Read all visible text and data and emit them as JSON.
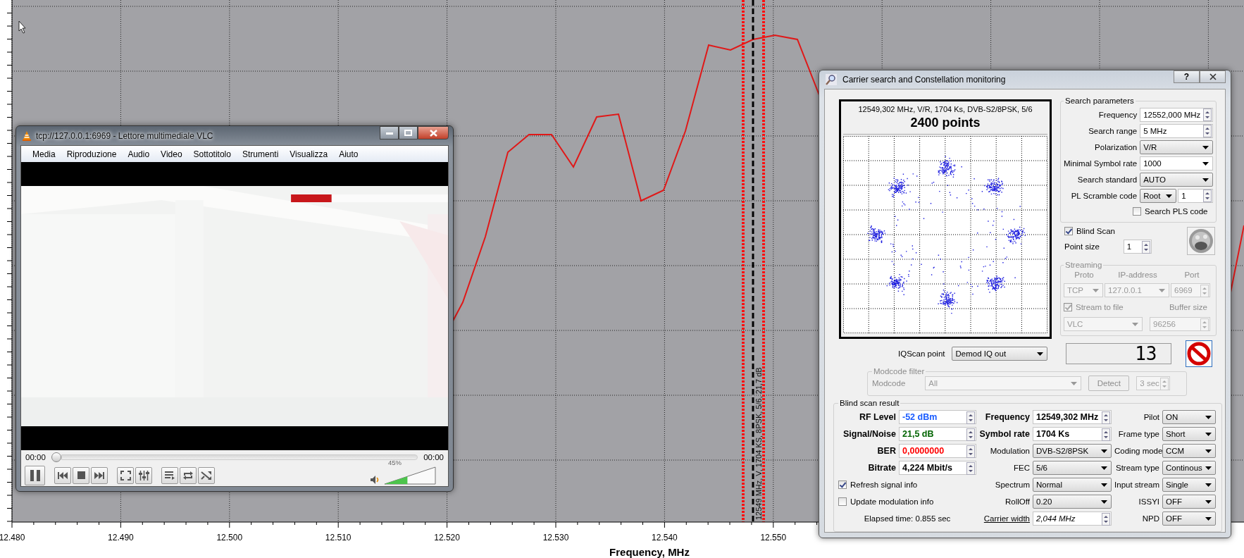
{
  "chart": {
    "x_ticks": [
      "12.480",
      "12.490",
      "12.500",
      "12.510",
      "12.520",
      "12.530",
      "12.540",
      "12.550"
    ],
    "x_label": "Frequency, MHz",
    "marker_label": "12549 MHz, V, 1704 KS, 8PSK, 5/6, 21,7 dB"
  },
  "vlc": {
    "title": "tcp://127.0.0.1:6969 - Lettore multimediale VLC",
    "menu": [
      "Media",
      "Riproduzione",
      "Audio",
      "Video",
      "Sottotitolo",
      "Strumenti",
      "Visualizza",
      "Aiuto"
    ],
    "elapsed": "00:00",
    "total": "00:00",
    "seek": {
      "level": 0
    },
    "volume": {
      "level": 0.45,
      "reading": "45%"
    }
  },
  "dialog": {
    "title": "Carrier search and Constellation monitoring",
    "help": "?",
    "constellation": {
      "info": "12549,302 MHz, V/R, 1704 Ks, DVB-S2/8PSK, 5/6",
      "points": "2400 points"
    },
    "search": {
      "title": "Search parameters",
      "fields": [
        {
          "label": "Frequency",
          "value": "12552,000 MHz",
          "kind": "spin"
        },
        {
          "label": "Search range",
          "value": "5 MHz",
          "kind": "spin"
        },
        {
          "label": "Polarization",
          "value": "V/R",
          "kind": "select"
        },
        {
          "label": "Minimal Symbol rate",
          "value": "1000",
          "kind": "combo"
        },
        {
          "label": "Search standard",
          "value": "AUTO",
          "kind": "select"
        },
        {
          "label": "PL Scramble code",
          "value": "Root",
          "extra": "1",
          "kind": "split"
        }
      ],
      "pls": {
        "label": "Search PLS code",
        "checked": false
      }
    },
    "blind_scan": {
      "label": "Blind Scan",
      "checked": true
    },
    "point_size": {
      "label": "Point size",
      "value": "1"
    },
    "streaming": {
      "title": "Streaming",
      "disabled": true,
      "proto_label": "Proto",
      "ip_label": "IP-address",
      "port_label": "Port",
      "proto": "TCP",
      "ip": "127.0.0.1",
      "port": "6969",
      "to_file": {
        "label": "Stream to file",
        "checked": true
      },
      "buffer_label": "Buffer size",
      "player": "VLC",
      "buffer": "96256"
    },
    "iq_scan": {
      "label": "IQScan point",
      "value": "Demod IQ out"
    },
    "counter": "13",
    "modcode": {
      "title": "Modcode filter",
      "disabled": true,
      "label": "Modcode",
      "value": "All",
      "detect": "Detect",
      "timeout": "3 sec"
    },
    "result": {
      "title": "Blind scan result",
      "left": [
        {
          "label": "RF Level",
          "value": "-52 dBm",
          "color": "#1a5cff"
        },
        {
          "label": "Signal/Noise",
          "value": "21,5 dB",
          "color": "#006400"
        },
        {
          "label": "BER",
          "value": "0,0000000",
          "color": "#ff0000"
        },
        {
          "label": "Bitrate",
          "value": "4,224 Mbit/s",
          "color": "#000000"
        }
      ],
      "checks": [
        {
          "label": "Refresh signal info",
          "checked": true
        },
        {
          "label": "Update modulation info",
          "checked": false
        }
      ],
      "elapsed": "Elapsed time: 0.855 sec",
      "middle": [
        {
          "label": "Frequency",
          "value": "12549,302 MHz",
          "kind": "spin",
          "bold": true
        },
        {
          "label": "Symbol rate",
          "value": "1704 Ks",
          "kind": "spin",
          "bold": true
        },
        {
          "label": "Modulation",
          "value": "DVB-S2/8PSK",
          "kind": "select",
          "bold": false
        },
        {
          "label": "FEC",
          "value": "5/6",
          "kind": "select",
          "bold": false
        },
        {
          "label": "Spectrum",
          "value": "Normal",
          "kind": "select",
          "bold": false
        },
        {
          "label": "RollOff",
          "value": "0.20",
          "kind": "select",
          "bold": false
        },
        {
          "label": "Carrier width",
          "value": "2,044 MHz",
          "kind": "link",
          "bold": false
        }
      ],
      "right": [
        {
          "label": "Pilot",
          "value": "ON"
        },
        {
          "label": "Frame type",
          "value": "Short"
        },
        {
          "label": "Coding mode",
          "value": "CCM"
        },
        {
          "label": "Stream type",
          "value": "Continous"
        },
        {
          "label": "Input stream",
          "value": "Single"
        },
        {
          "label": "ISSYI",
          "value": "OFF"
        },
        {
          "label": "NPD",
          "value": "OFF"
        }
      ]
    }
  }
}
